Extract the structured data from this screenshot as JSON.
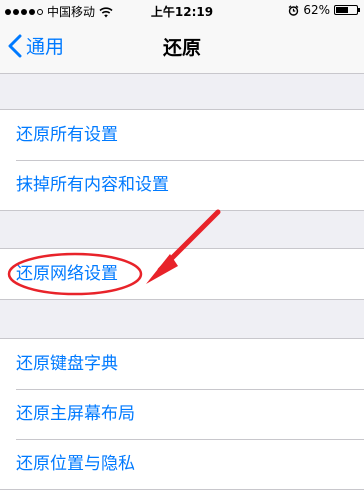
{
  "status_bar": {
    "carrier": "中国移动",
    "time": "上午12:19",
    "battery": "62%",
    "battery_level": 0.62,
    "icons": [
      "signal-dots",
      "wifi-icon",
      "alarm-icon",
      "battery-icon"
    ]
  },
  "nav": {
    "back_label": "通用",
    "title": "还原"
  },
  "sections": [
    {
      "items": [
        "还原所有设置",
        "抹掉所有内容和设置"
      ]
    },
    {
      "items": [
        "还原网络设置"
      ]
    },
    {
      "items": [
        "还原键盘字典",
        "还原主屏幕布局",
        "还原位置与隐私"
      ]
    }
  ],
  "annotation": {
    "highlighted_item": "还原网络设置",
    "color": "#e8232a",
    "shapes": [
      "ellipse",
      "arrow"
    ]
  },
  "colors": {
    "accent": "#007aff",
    "background": "#efeff4",
    "separator": "#c8c7cc"
  }
}
